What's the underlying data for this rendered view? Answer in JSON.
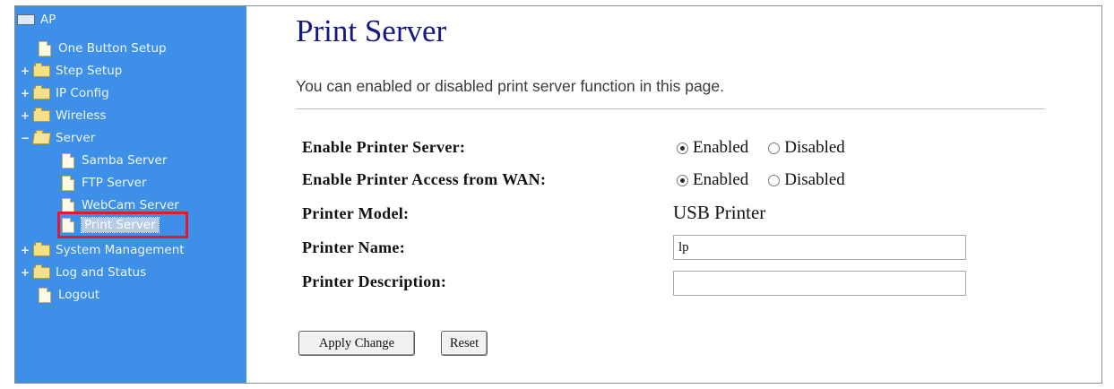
{
  "sidebar": {
    "root": "AP",
    "items": [
      {
        "label": "One Button Setup",
        "expander": "",
        "icon": "page-icon"
      },
      {
        "label": "Step Setup",
        "expander": "+",
        "icon": "folder-icon"
      },
      {
        "label": "IP Config",
        "expander": "+",
        "icon": "folder-icon"
      },
      {
        "label": "Wireless",
        "expander": "+",
        "icon": "folder-icon"
      },
      {
        "label": "Server",
        "expander": "−",
        "icon": "folder-open-icon"
      },
      {
        "label": "Samba Server",
        "expander": "",
        "icon": "page-icon"
      },
      {
        "label": "FTP Server",
        "expander": "",
        "icon": "page-icon"
      },
      {
        "label": "WebCam Server",
        "expander": "",
        "icon": "page-icon"
      },
      {
        "label": "Print Server",
        "expander": "",
        "icon": "page-icon",
        "selected": true
      },
      {
        "label": "System Management",
        "expander": "+",
        "icon": "folder-icon"
      },
      {
        "label": "Log and Status",
        "expander": "+",
        "icon": "folder-icon"
      },
      {
        "label": "Logout",
        "expander": "",
        "icon": "page-icon"
      }
    ]
  },
  "main": {
    "title": "Print Server",
    "description": "You can enabled or disabled print server function in this page.",
    "fields": {
      "enable_printer_server": {
        "label": "Enable Printer Server:",
        "enabled": "Enabled",
        "disabled": "Disabled",
        "value": "Enabled"
      },
      "enable_wan_access": {
        "label": "Enable Printer Access from WAN:",
        "enabled": "Enabled",
        "disabled": "Disabled",
        "value": "Enabled"
      },
      "printer_model": {
        "label": "Printer Model:",
        "value": "USB Printer"
      },
      "printer_name": {
        "label": "Printer Name:",
        "value": "lp"
      },
      "printer_description": {
        "label": "Printer Description:",
        "value": ""
      }
    },
    "buttons": {
      "apply": "Apply Change",
      "reset": "Reset"
    }
  },
  "colors": {
    "sidebar_bg": "#3d8fe8",
    "title": "#16197f",
    "highlight_box": "#e01c2c"
  }
}
